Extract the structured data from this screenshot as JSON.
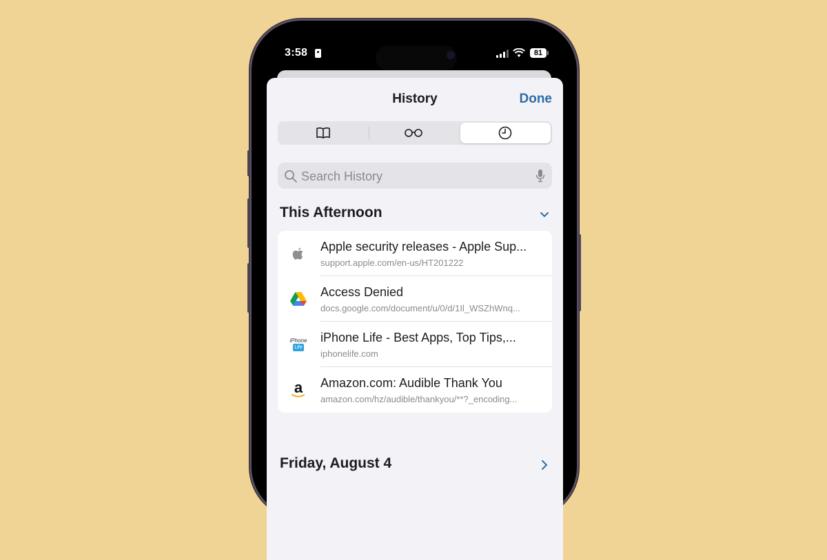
{
  "status_bar": {
    "time": "3:58",
    "battery": "81"
  },
  "header": {
    "title": "History",
    "done_label": "Done"
  },
  "tabs": [
    {
      "icon": "book-icon",
      "label": "Bookmarks",
      "active": false
    },
    {
      "icon": "glasses-icon",
      "label": "Reading List",
      "active": false
    },
    {
      "icon": "clock-icon",
      "label": "History",
      "active": true
    }
  ],
  "search": {
    "placeholder": "Search History",
    "value": ""
  },
  "sections": [
    {
      "title": "This Afternoon",
      "expanded": true,
      "items": [
        {
          "favicon": "apple-icon",
          "title": "Apple security releases - Apple Sup...",
          "url": "support.apple.com/en-us/HT201222"
        },
        {
          "favicon": "google-drive-icon",
          "title": "Access Denied",
          "url": "docs.google.com/document/u/0/d/1Il_WSZhWnq..."
        },
        {
          "favicon": "iphone-life-icon",
          "title": "iPhone Life - Best Apps, Top Tips,...",
          "url": "iphonelife.com",
          "favicon_text_top": "iPhone",
          "favicon_text_bottom": "Life"
        },
        {
          "favicon": "amazon-icon",
          "title": "Amazon.com: Audible Thank You",
          "url": "amazon.com/hz/audible/thankyou/**?_encoding...",
          "favicon_text": "a"
        }
      ]
    },
    {
      "title": "Friday, August 4",
      "expanded": false
    }
  ],
  "colors": {
    "accent": "#2E6DA4",
    "background": "#F0D496"
  }
}
